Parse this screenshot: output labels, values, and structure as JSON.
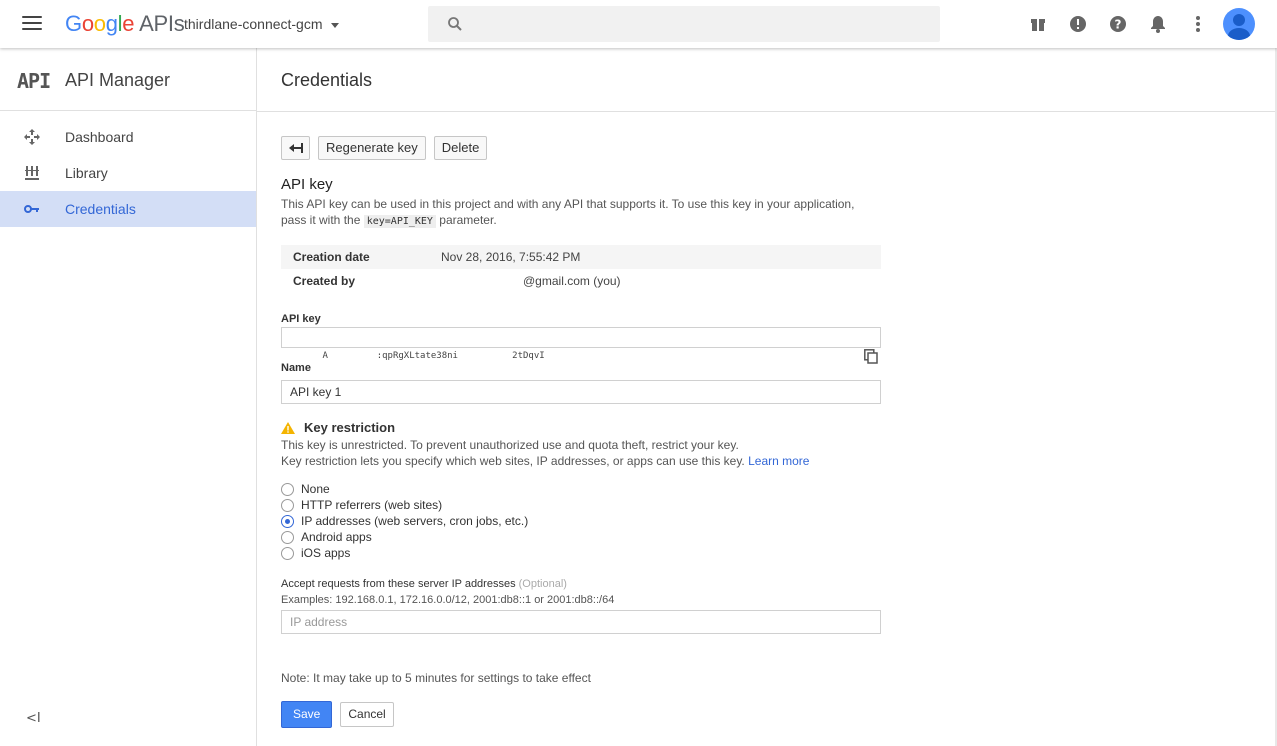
{
  "topbar": {
    "logo_google": [
      "G",
      "o",
      "o",
      "g",
      "l",
      "e"
    ],
    "logo_apis": "APIs",
    "project_name": "thirdlane-connect-gcm",
    "search_placeholder": ""
  },
  "sidebar": {
    "logo_text": "API",
    "title": "API Manager",
    "items": [
      {
        "label": "Dashboard",
        "icon": "dashboard-icon"
      },
      {
        "label": "Library",
        "icon": "library-icon"
      },
      {
        "label": "Credentials",
        "icon": "key-icon"
      }
    ],
    "collapse_label": "<I"
  },
  "main": {
    "title": "Credentials",
    "buttons": {
      "back": "←",
      "regenerate": "Regenerate key",
      "delete": "Delete"
    },
    "api_key_section": {
      "title": "API key",
      "desc_before": "This API key can be used in this project and with any API that supports it. To use this key in your application, pass it with the ",
      "desc_code": "key=API_KEY",
      "desc_after": " parameter."
    },
    "info": {
      "creation_label": "Creation date",
      "creation_value": "Nov 28, 2016, 7:55:42 PM",
      "created_by_label": "Created by",
      "created_by_value": "@gmail.com (you)"
    },
    "key_field": {
      "label": "API key",
      "value": "A         :qpRgXLtate38ni          2tDqvI"
    },
    "name_field": {
      "label": "Name",
      "value": "API key 1"
    },
    "restriction": {
      "title": "Key restriction",
      "line1": "This key is unrestricted. To prevent unauthorized use and quota theft, restrict your key.",
      "line2": "Key restriction lets you specify which web sites, IP addresses, or apps can use this key. ",
      "learn_more": "Learn more",
      "options": [
        {
          "label": "None",
          "selected": false
        },
        {
          "label": "HTTP referrers (web sites)",
          "selected": false
        },
        {
          "label": "IP addresses (web servers, cron jobs, etc.)",
          "selected": true
        },
        {
          "label": "Android apps",
          "selected": false
        },
        {
          "label": "iOS apps",
          "selected": false
        }
      ]
    },
    "ip_field": {
      "label": "Accept requests from these server IP addresses",
      "optional": "(Optional)",
      "examples": "Examples: 192.168.0.1, 172.16.0.0/12, 2001:db8::1 or 2001:db8::/64",
      "placeholder": "IP address"
    },
    "note": "Note: It may take up to 5 minutes for settings to take effect",
    "save_label": "Save",
    "cancel_label": "Cancel"
  },
  "colors": {
    "accent": "#4285f4",
    "active_bg": "#d3def6",
    "active_text": "#3367d6",
    "warning": "#f4b400"
  }
}
